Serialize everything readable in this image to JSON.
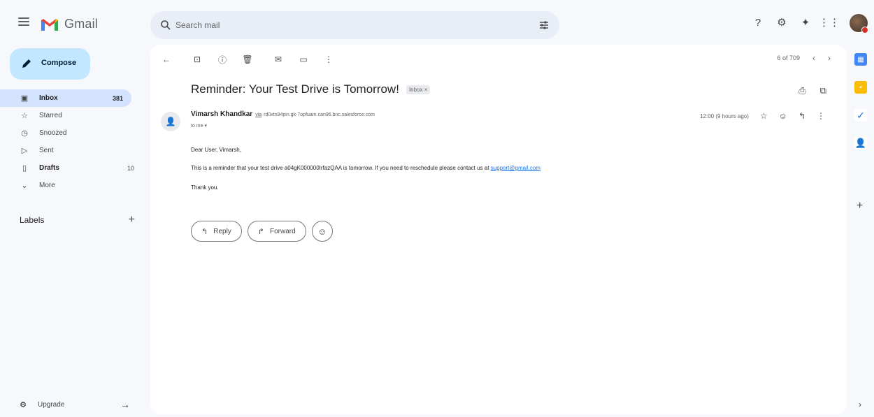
{
  "app": {
    "name": "Gmail"
  },
  "search": {
    "placeholder": "Search mail"
  },
  "compose": {
    "label": "Compose"
  },
  "nav": {
    "items": [
      {
        "label": "Inbox",
        "count": "381"
      },
      {
        "label": "Starred",
        "count": ""
      },
      {
        "label": "Snoozed",
        "count": ""
      },
      {
        "label": "Sent",
        "count": ""
      },
      {
        "label": "Drafts",
        "count": "10"
      },
      {
        "label": "More",
        "count": ""
      }
    ]
  },
  "labels": {
    "title": "Labels"
  },
  "upgrade": {
    "label": "Upgrade"
  },
  "pager": {
    "text": "6 of 709"
  },
  "email": {
    "subject": "Reminder: Your Test Drive is Tomorrow!",
    "label_chip": "Inbox ×",
    "sender_name": "Vimarsh Khandkar",
    "via": "via",
    "sender_address": "rd0xtn94pin.gk-7opfuam.can96.bnc.salesforce.com",
    "to": "to me ▾",
    "time": "12:00 (9 hours ago)",
    "greeting": "Dear User, Vimarsh,",
    "body_prefix": "This is a reminder that your test drive a04gK000000IrfazQAA is tomorrow. If you need to reschedule please contact us at ",
    "support_email": "support@gmail.com",
    "closing": "Thank you."
  },
  "actions": {
    "reply": "Reply",
    "forward": "Forward"
  },
  "colors": {
    "compose_bg": "#c2e7ff",
    "active_nav_bg": "#d3e3fd",
    "link": "#1a73e8",
    "gmail_red": "#ea4335"
  }
}
